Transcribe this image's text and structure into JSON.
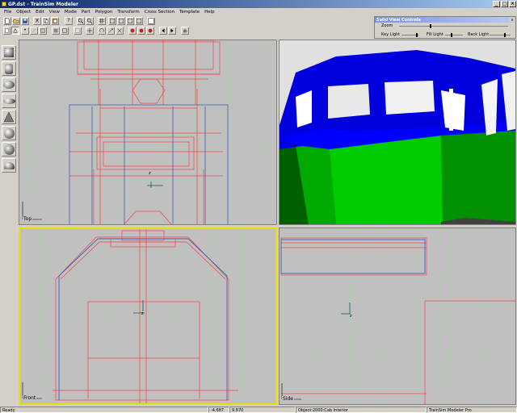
{
  "window": {
    "title": "GP.dst - TrainSim Modeler"
  },
  "menu": [
    "File",
    "Object",
    "Edit",
    "View",
    "Mode",
    "Part",
    "Polygon",
    "Transform",
    "Cross Section",
    "Template",
    "Help"
  ],
  "solid_view_controls": {
    "title": "Solid View Controls",
    "zoom": "Zoom",
    "key_light": "Key Light",
    "fill_light": "Fill Light",
    "back_light": "Back Light"
  },
  "viewports": {
    "top": "Top",
    "front": "Front",
    "side": "Side"
  },
  "status": {
    "ready": "Ready",
    "coord_x": "-4.687",
    "coord_y": "9.870",
    "object": "Object:2000:Cab Interior",
    "product": "TrainSim Modeler Pro"
  },
  "colors": {
    "grid": "#a8d0a0",
    "red_line": "#ff4040",
    "blue_line": "#4060c0",
    "loco_blue": "#0000dd",
    "loco_green": "#008800",
    "active_border": "#e8e000"
  }
}
